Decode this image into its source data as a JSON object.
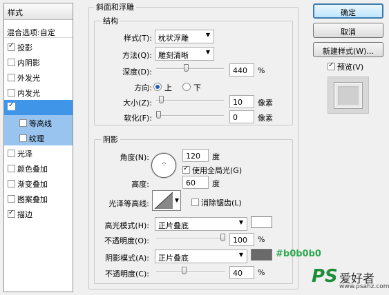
{
  "left_panel": {
    "header": "样式",
    "blend_options": "混合选项:自定",
    "items": [
      {
        "label": "投影",
        "checked": true
      },
      {
        "label": "内阴影",
        "checked": false
      },
      {
        "label": "外发光",
        "checked": false
      },
      {
        "label": "内发光",
        "checked": false
      },
      {
        "label": "",
        "checked": true,
        "selected": true
      },
      {
        "label": "等高线",
        "checked": false,
        "sub": true
      },
      {
        "label": "纹理",
        "checked": false,
        "sub": true
      },
      {
        "label": "光泽",
        "checked": false
      },
      {
        "label": "颜色叠加",
        "checked": false
      },
      {
        "label": "渐变叠加",
        "checked": false
      },
      {
        "label": "图案叠加",
        "checked": false
      },
      {
        "label": "描边",
        "checked": true
      }
    ]
  },
  "bevel": {
    "title": "斜面和浮雕",
    "structure": {
      "title": "结构",
      "style_label": "样式(T):",
      "style_value": "枕状浮雕",
      "technique_label": "方法(Q):",
      "technique_value": "雕刻清晰",
      "depth_label": "深度(D):",
      "depth_value": "440",
      "depth_unit": "%",
      "depth_level": 0.44,
      "direction_label": "方向:",
      "direction_up": "上",
      "direction_down": "下",
      "direction_selected": "上",
      "size_label": "大小(Z):",
      "size_value": "10",
      "size_unit": "像素",
      "size_level": 0.04,
      "soften_label": "软化(F):",
      "soften_value": "0",
      "soften_unit": "像素",
      "soften_level": 0.0
    },
    "shading": {
      "title": "阴影",
      "angle_label": "角度(N):",
      "angle_value": "120",
      "angle_unit": "度",
      "global_light_label": "使用全局光(G)",
      "global_light_checked": true,
      "altitude_label": "高度:",
      "altitude_value": "60",
      "altitude_unit": "度",
      "gloss_label": "光泽等高线:",
      "antialias_label": "消除锯齿(L)",
      "antialias_checked": false,
      "highlight_mode_label": "高光模式(H):",
      "highlight_mode_value": "正片叠底",
      "highlight_color": "#ffffff",
      "highlight_opacity_label": "不透明度(O):",
      "highlight_opacity_value": "100",
      "highlight_opacity_level": 1.0,
      "shadow_mode_label": "阴影模式(A):",
      "shadow_mode_value": "正片叠底",
      "shadow_color": "#6a6a6a",
      "shadow_color_note": "#b0b0b0",
      "shadow_opacity_label": "不透明度(C):",
      "shadow_opacity_value": "40",
      "shadow_opacity_level": 0.4,
      "percent": "%"
    }
  },
  "buttons": {
    "ok": "确定",
    "cancel": "取消",
    "new_style": "新建样式(W)...",
    "preview_label": "预览(V)",
    "preview_checked": true
  },
  "watermark": {
    "brand": "PS",
    "text": "爱好者",
    "url": "www.psahz.com"
  },
  "colors": {
    "accent": "#3f95e8",
    "sub_bg": "#99c4ef",
    "annotation": "#2fa84f"
  }
}
